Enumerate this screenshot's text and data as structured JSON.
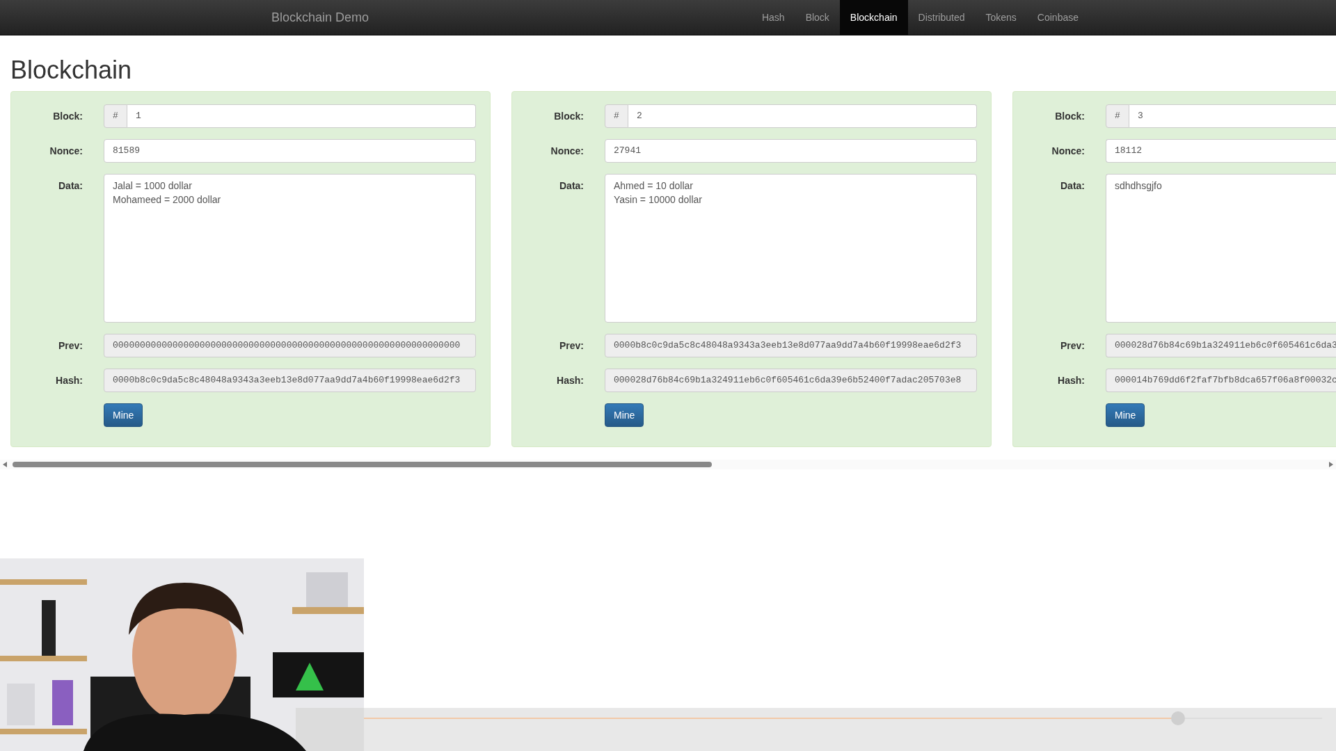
{
  "navbar": {
    "brand": "Blockchain Demo",
    "items": [
      {
        "label": "Hash",
        "selected": false
      },
      {
        "label": "Block",
        "selected": false
      },
      {
        "label": "Blockchain",
        "selected": true
      },
      {
        "label": "Distributed",
        "selected": false
      },
      {
        "label": "Tokens",
        "selected": false
      },
      {
        "label": "Coinbase",
        "selected": false
      }
    ]
  },
  "page_title": "Blockchain",
  "blocks": [
    {
      "labels": {
        "block": "Block:",
        "nonce": "Nonce:",
        "data": "Data:",
        "prev": "Prev:",
        "hash": "Hash:"
      },
      "block_prefix": "#",
      "block": "1",
      "nonce": "81589",
      "data": [
        "Jalal = 1000 dollar",
        "Mohameed = 2000 dollar"
      ],
      "prev": "0000000000000000000000000000000000000000000000000000000000000000",
      "hash": "0000b8c0c9da5c8c48048a9343a3eeb13e8d077aa9dd7a4b60f19998eae6d2f3",
      "button": "Mine"
    },
    {
      "labels": {
        "block": "Block:",
        "nonce": "Nonce:",
        "data": "Data:",
        "prev": "Prev:",
        "hash": "Hash:"
      },
      "block_prefix": "#",
      "block": "2",
      "nonce": "27941",
      "data": [
        "Ahmed = 10 dollar",
        "Yasin = 10000 dollar"
      ],
      "prev": "0000b8c0c9da5c8c48048a9343a3eeb13e8d077aa9dd7a4b60f19998eae6d2f3",
      "hash": "000028d76b84c69b1a324911eb6c0f605461c6da39e6b52400f7adac205703e8",
      "button": "Mine"
    },
    {
      "labels": {
        "block": "Block:",
        "nonce": "Nonce:",
        "data": "Data:",
        "prev": "Prev:",
        "hash": "Hash:"
      },
      "block_prefix": "#",
      "block": "3",
      "nonce": "18112",
      "data": [
        "sdhdhsgjfo"
      ],
      "prev": "000028d76b84c69b1a324911eb6c0f605461c6da3",
      "hash": "000014b769dd6f2faf7bfb8dca657f06a8f00032c",
      "button": "Mine"
    }
  ],
  "player": {
    "level": 0.85
  }
}
